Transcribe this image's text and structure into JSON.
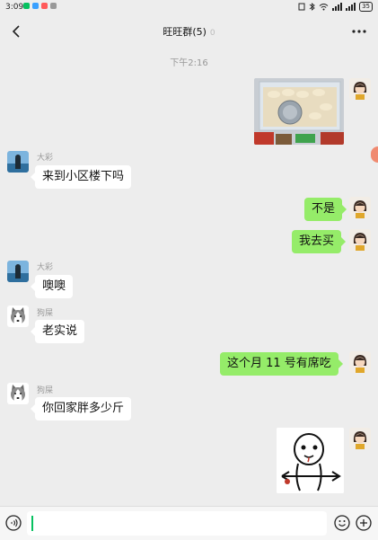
{
  "status_bar": {
    "time": "3:09",
    "battery": "35",
    "icons": [
      "notification-icon",
      "alarm-icon",
      "bluetooth-icon",
      "wifi-icon",
      "signal-icon"
    ]
  },
  "header": {
    "title": "旺旺群(5)",
    "mute_indicator": "0",
    "icons": [
      "back-icon",
      "more-icon"
    ]
  },
  "chat": {
    "timestamp": "下午2:16",
    "messages": [
      {
        "side": "out",
        "type": "image",
        "content": "photo"
      },
      {
        "side": "in",
        "sender": "大彩",
        "type": "text",
        "text": "来到小区楼下吗"
      },
      {
        "side": "out",
        "type": "text",
        "text": "不是"
      },
      {
        "side": "out",
        "type": "text",
        "text": "我去买"
      },
      {
        "side": "in",
        "sender": "大彩",
        "type": "text",
        "text": "噢噢"
      },
      {
        "side": "in",
        "sender": "狗屎",
        "type": "text",
        "text": "老实说"
      },
      {
        "side": "out",
        "type": "text",
        "text": "这个月 11 号有席吃"
      },
      {
        "side": "in",
        "sender": "狗屎",
        "type": "text",
        "text": "你回家胖多少斤"
      },
      {
        "side": "out",
        "type": "sticker",
        "content": "sticker"
      }
    ]
  },
  "input_bar": {
    "value": "",
    "icons": [
      "voice-icon",
      "emoji-icon",
      "plus-icon"
    ]
  },
  "colors": {
    "background": "#ededed",
    "out_bubble": "#95ec69",
    "in_bubble": "#ffffff",
    "accent": "#07c160"
  }
}
